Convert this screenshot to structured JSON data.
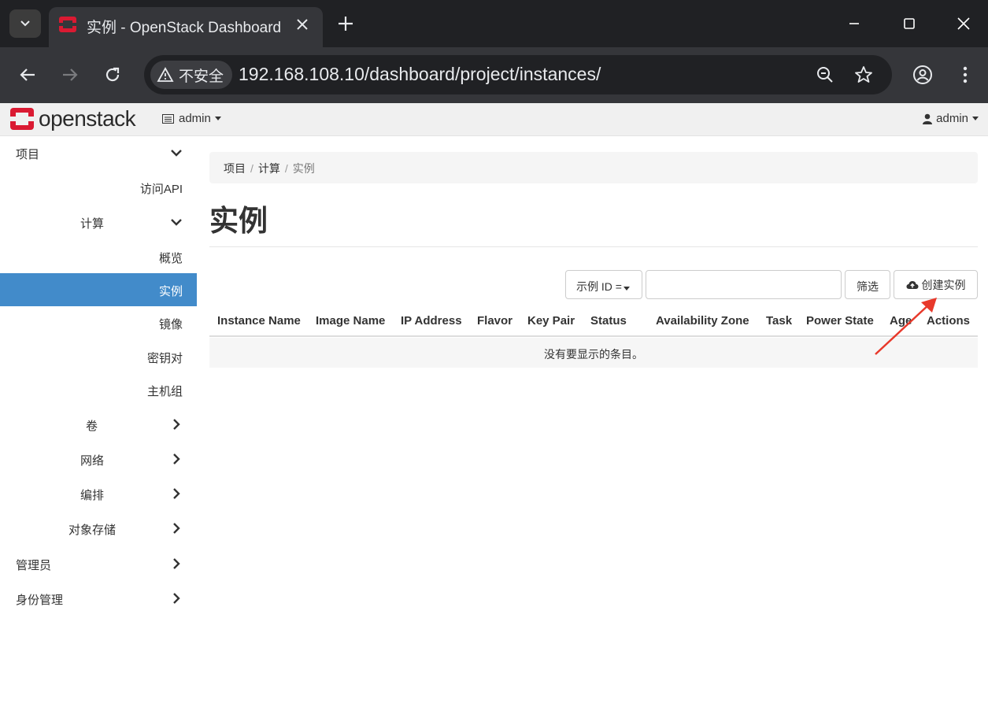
{
  "browser": {
    "tab_title": "实例 - OpenStack Dashboard",
    "security_label": "不安全",
    "url": "192.168.108.10/dashboard/project/instances/"
  },
  "header": {
    "logo_text": "openstack",
    "project_label": "admin",
    "user_label": "admin"
  },
  "sidebar": {
    "items": [
      {
        "label": "项目",
        "icon": "chevron-down-icon"
      },
      {
        "label": "访问API"
      },
      {
        "label": "计算",
        "icon": "chevron-down-icon"
      },
      {
        "label": "概览"
      },
      {
        "label": "实例",
        "active": true
      },
      {
        "label": "镜像"
      },
      {
        "label": "密钥对"
      },
      {
        "label": "主机组"
      },
      {
        "label": "卷",
        "icon": "chevron-right-icon"
      },
      {
        "label": "网络",
        "icon": "chevron-right-icon"
      },
      {
        "label": "编排",
        "icon": "chevron-right-icon"
      },
      {
        "label": "对象存储",
        "icon": "chevron-right-icon"
      },
      {
        "label": "管理员",
        "icon": "chevron-right-icon"
      },
      {
        "label": "身份管理",
        "icon": "chevron-right-icon"
      }
    ]
  },
  "breadcrumb": [
    "项目",
    "计算",
    "实例"
  ],
  "page": {
    "title": "实例"
  },
  "filter": {
    "select_label": "示例 ID =",
    "input_value": "",
    "filter_button": "筛选",
    "create_button": "创建实例"
  },
  "table": {
    "columns": [
      "Instance Name",
      "Image Name",
      "IP Address",
      "Flavor",
      "Key Pair",
      "Status",
      "Availability Zone",
      "Task",
      "Power State",
      "Age",
      "Actions"
    ],
    "empty_message": "没有要显示的条目。"
  },
  "colors": {
    "accent": "#428bca",
    "brand": "#da1a32",
    "annotation_arrow": "#e8392b"
  }
}
